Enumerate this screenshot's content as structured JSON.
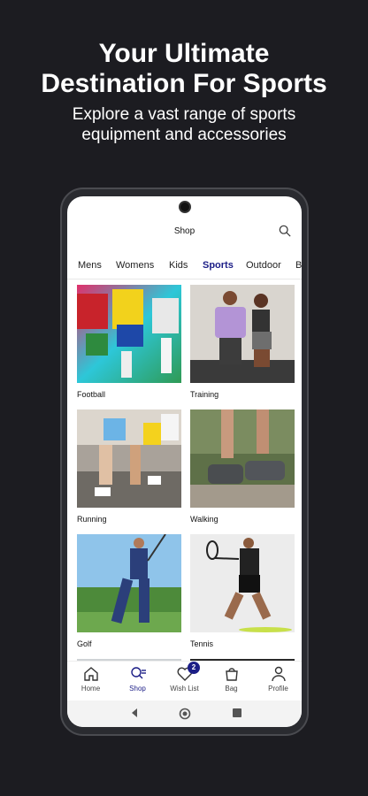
{
  "promo": {
    "title_line1": "Your Ultimate",
    "title_line2": "Destination For Sports",
    "subtitle_line1": "Explore a vast range of sports",
    "subtitle_line2": "equipment and accessories"
  },
  "app": {
    "title": "Shop",
    "categories": [
      "Mens",
      "Womens",
      "Kids",
      "Sports",
      "Outdoor",
      "B"
    ],
    "active_category": "Sports",
    "tiles": [
      {
        "label": "Football",
        "icon": "football-photo"
      },
      {
        "label": "Training",
        "icon": "training-photo"
      },
      {
        "label": "Running",
        "icon": "running-photo"
      },
      {
        "label": "Walking",
        "icon": "walking-photo"
      },
      {
        "label": "Golf",
        "icon": "golf-photo"
      },
      {
        "label": "Tennis",
        "icon": "tennis-photo"
      }
    ],
    "nav": [
      {
        "label": "Home",
        "icon": "home-icon"
      },
      {
        "label": "Shop",
        "icon": "shop-icon"
      },
      {
        "label": "Wish List",
        "icon": "heart-icon",
        "badge": "2"
      },
      {
        "label": "Bag",
        "icon": "bag-icon"
      },
      {
        "label": "Profile",
        "icon": "profile-icon"
      }
    ],
    "active_nav": "Shop"
  },
  "colors": {
    "accent": "#1b1d86",
    "background": "#1c1c21"
  }
}
